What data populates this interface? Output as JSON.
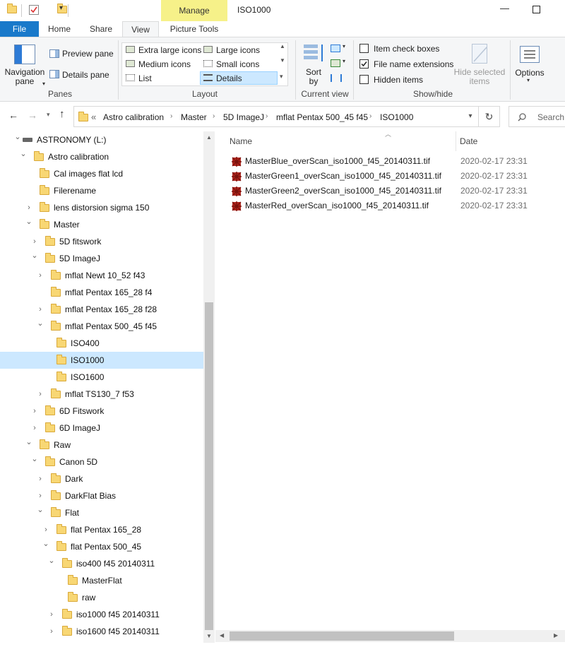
{
  "window": {
    "title": "ISO1000",
    "minimize_glyph": "—",
    "maximize_glyph": "☐"
  },
  "ribbon_tabs": {
    "file": "File",
    "home": "Home",
    "share": "Share",
    "view": "View",
    "context_header": "Manage",
    "picture_tools": "Picture Tools"
  },
  "panes": {
    "navigation_pane": "Navigation pane",
    "preview_pane": "Preview pane",
    "details_pane": "Details pane",
    "label": "Panes"
  },
  "layout": {
    "extra_large": "Extra large icons",
    "large": "Large icons",
    "medium": "Medium icons",
    "small": "Small icons",
    "list": "List",
    "details": "Details",
    "label": "Layout"
  },
  "current_view": {
    "sort_by": "Sort by",
    "label": "Current view"
  },
  "show_hide": {
    "item_check_boxes": "Item check boxes",
    "item_check_boxes_checked": false,
    "file_name_extensions": "File name extensions",
    "file_name_extensions_checked": true,
    "hidden_items": "Hidden items",
    "hidden_items_checked": false,
    "hide_selected_items": "Hide selected items",
    "label": "Show/hide"
  },
  "options": {
    "label": "Options"
  },
  "address": {
    "overflow": "«",
    "crumbs": [
      "Astro calibration",
      "Master",
      "5D ImageJ",
      "mflat Pentax 500_45 f45",
      "ISO1000"
    ],
    "search_placeholder": "Search"
  },
  "tree": [
    {
      "label": "ASTRONOMY (L:)",
      "level": 0,
      "expand": "open",
      "icon": "drive"
    },
    {
      "label": "Astro calibration",
      "level": 1,
      "expand": "open"
    },
    {
      "label": "Cal images flat lcd",
      "level": 2,
      "expand": "none"
    },
    {
      "label": "Filerename",
      "level": 2,
      "expand": "none"
    },
    {
      "label": "lens distorsion sigma 150",
      "level": 2,
      "expand": "closed"
    },
    {
      "label": "Master",
      "level": 2,
      "expand": "open"
    },
    {
      "label": "5D fitswork",
      "level": 3,
      "expand": "closed"
    },
    {
      "label": "5D ImageJ",
      "level": 3,
      "expand": "open"
    },
    {
      "label": "mflat Newt 10_52 f43",
      "level": 4,
      "expand": "closed"
    },
    {
      "label": "mflat Pentax 165_28 f4",
      "level": 4,
      "expand": "none"
    },
    {
      "label": "mflat Pentax 165_28 f28",
      "level": 4,
      "expand": "closed"
    },
    {
      "label": "mflat Pentax 500_45 f45",
      "level": 4,
      "expand": "open"
    },
    {
      "label": "ISO400",
      "level": 5,
      "expand": "none"
    },
    {
      "label": "ISO1000",
      "level": 5,
      "expand": "none",
      "selected": true
    },
    {
      "label": "ISO1600",
      "level": 5,
      "expand": "none"
    },
    {
      "label": "mflat TS130_7 f53",
      "level": 4,
      "expand": "closed"
    },
    {
      "label": "6D Fitswork",
      "level": 3,
      "expand": "closed"
    },
    {
      "label": "6D ImageJ",
      "level": 3,
      "expand": "closed"
    },
    {
      "label": "Raw",
      "level": 2,
      "expand": "open"
    },
    {
      "label": "Canon 5D",
      "level": 3,
      "expand": "open"
    },
    {
      "label": "Dark",
      "level": 4,
      "expand": "closed"
    },
    {
      "label": "DarkFlat Bias",
      "level": 4,
      "expand": "closed"
    },
    {
      "label": "Flat",
      "level": 4,
      "expand": "open"
    },
    {
      "label": "flat Pentax 165_28",
      "level": 5,
      "expand": "closed"
    },
    {
      "label": "flat Pentax 500_45",
      "level": 5,
      "expand": "open"
    },
    {
      "label": "iso400 f45 20140311",
      "level": 6,
      "expand": "open"
    },
    {
      "label": "MasterFlat",
      "level": 7,
      "expand": "none"
    },
    {
      "label": "raw",
      "level": 7,
      "expand": "none"
    },
    {
      "label": "iso1000 f45 20140311",
      "level": 6,
      "expand": "closed"
    },
    {
      "label": "iso1600 f45 20140311",
      "level": 6,
      "expand": "closed"
    }
  ],
  "file_list": {
    "col_name": "Name",
    "col_date": "Date",
    "files": [
      {
        "name": "MasterBlue_overScan_iso1000_f45_20140311.tif",
        "date": "2020-02-17 23:31"
      },
      {
        "name": "MasterGreen1_overScan_iso1000_f45_20140311.tif",
        "date": "2020-02-17 23:31"
      },
      {
        "name": "MasterGreen2_overScan_iso1000_f45_20140311.tif",
        "date": "2020-02-17 23:31"
      },
      {
        "name": "MasterRed_overScan_iso1000_f45_20140311.tif",
        "date": "2020-02-17 23:31"
      }
    ]
  },
  "colors": {
    "accent": "#1979ca",
    "selection": "#cce8ff",
    "context_tab": "#f6f189"
  }
}
